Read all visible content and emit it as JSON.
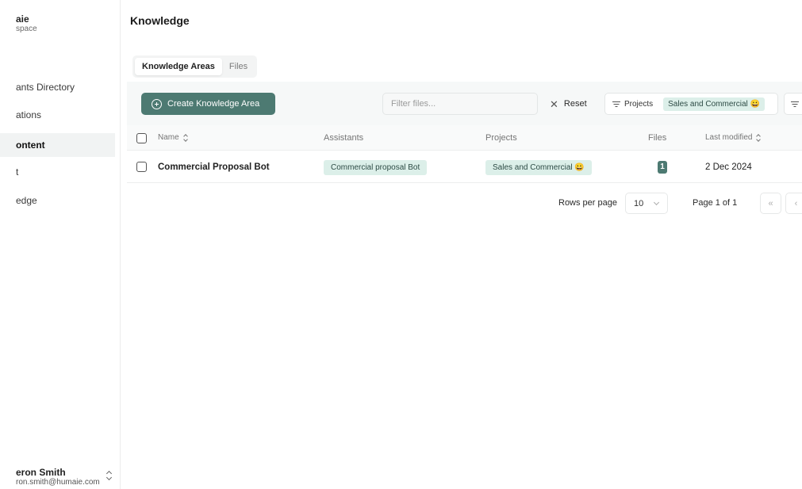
{
  "sidebar": {
    "workspace_name": "aie",
    "workspace_sub": "space",
    "items": [
      {
        "label": "ants Directory"
      },
      {
        "label": "ations"
      },
      {
        "label": "ontent"
      },
      {
        "label": "t"
      },
      {
        "label": "edge"
      }
    ],
    "active_index": 2,
    "user": {
      "name": "eron Smith",
      "email": "ron.smith@humaie.com"
    }
  },
  "header": {
    "title": "Knowledge"
  },
  "tabs": [
    {
      "label": "Knowledge Areas",
      "active": true
    },
    {
      "label": "Files",
      "active": false
    }
  ],
  "toolbar": {
    "create_label": "Create Knowledge Area",
    "filter_placeholder": "Filter files...",
    "reset_label": "Reset",
    "projects_label": "Projects",
    "projects_selected": "Sales and Commercial 😀"
  },
  "table": {
    "columns": {
      "name": "Name",
      "assistants": "Assistants",
      "projects": "Projects",
      "files": "Files",
      "last_modified": "Last modified"
    },
    "rows": [
      {
        "name": "Commercial Proposal Bot",
        "assistant": "Commercial proposal Bot",
        "project": "Sales and Commercial 😀",
        "files": "1",
        "last_modified": "2 Dec 2024"
      }
    ]
  },
  "pagination": {
    "rows_per_page_label": "Rows per page",
    "rows_per_page_value": "10",
    "page_label": "Page 1 of 1",
    "first_label": "«",
    "prev_label": "‹"
  },
  "colors": {
    "accent": "#4d7a72",
    "chip_bg": "#dcefe9",
    "toolbar_bg": "#f6f8f8"
  }
}
